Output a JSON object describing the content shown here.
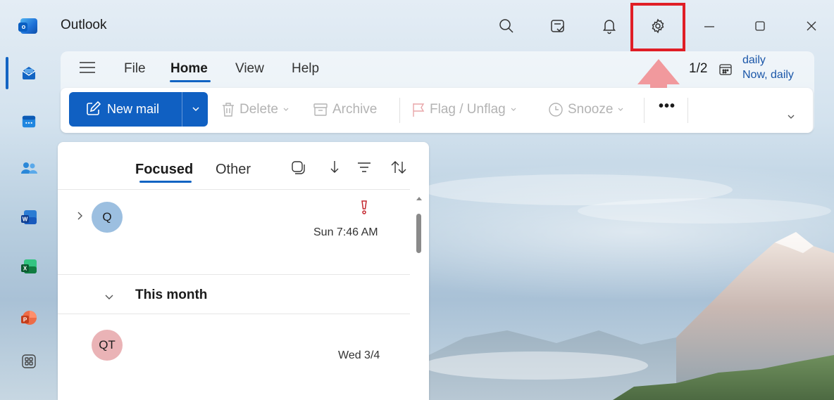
{
  "app": {
    "title": "Outlook",
    "logo_letter": "o"
  },
  "titlebar": {
    "icons": [
      "search-icon",
      "todo-icon",
      "notifications-icon",
      "settings-icon"
    ],
    "window_controls": [
      "minimize-icon",
      "maximize-icon",
      "close-icon"
    ],
    "highlight_color": "#e01e26"
  },
  "rail": {
    "items": [
      "mail-icon",
      "calendar-icon",
      "people-icon",
      "word-icon",
      "excel-icon",
      "powerpoint-icon",
      "more-apps-icon"
    ],
    "word_letter": "W",
    "excel_letter": "X",
    "powerpoint_letter": "P"
  },
  "menu": {
    "tabs": [
      "File",
      "Home",
      "View",
      "Help"
    ],
    "active_tab": "Home",
    "reminder_counter": "1/2",
    "reminder_title": "daily",
    "reminder_subtitle": "Now, daily"
  },
  "commands": {
    "new_mail": "New mail",
    "delete": "Delete",
    "archive": "Archive",
    "flag": "Flag / Unflag",
    "snooze": "Snooze",
    "more": "•••"
  },
  "mail_list": {
    "tabs": [
      "Focused",
      "Other"
    ],
    "active_tab": "Focused",
    "items": [
      {
        "initials": "Q",
        "time": "Sun 7:46 AM",
        "avatar_color": "#9cbfe0",
        "important": true
      },
      {
        "initials": "QT",
        "time": "Wed 3/4",
        "avatar_color": "#eab3b6",
        "important": false
      }
    ],
    "group_label": "This month"
  },
  "colors": {
    "accent": "#1060c2",
    "importance": "#c4262e"
  }
}
